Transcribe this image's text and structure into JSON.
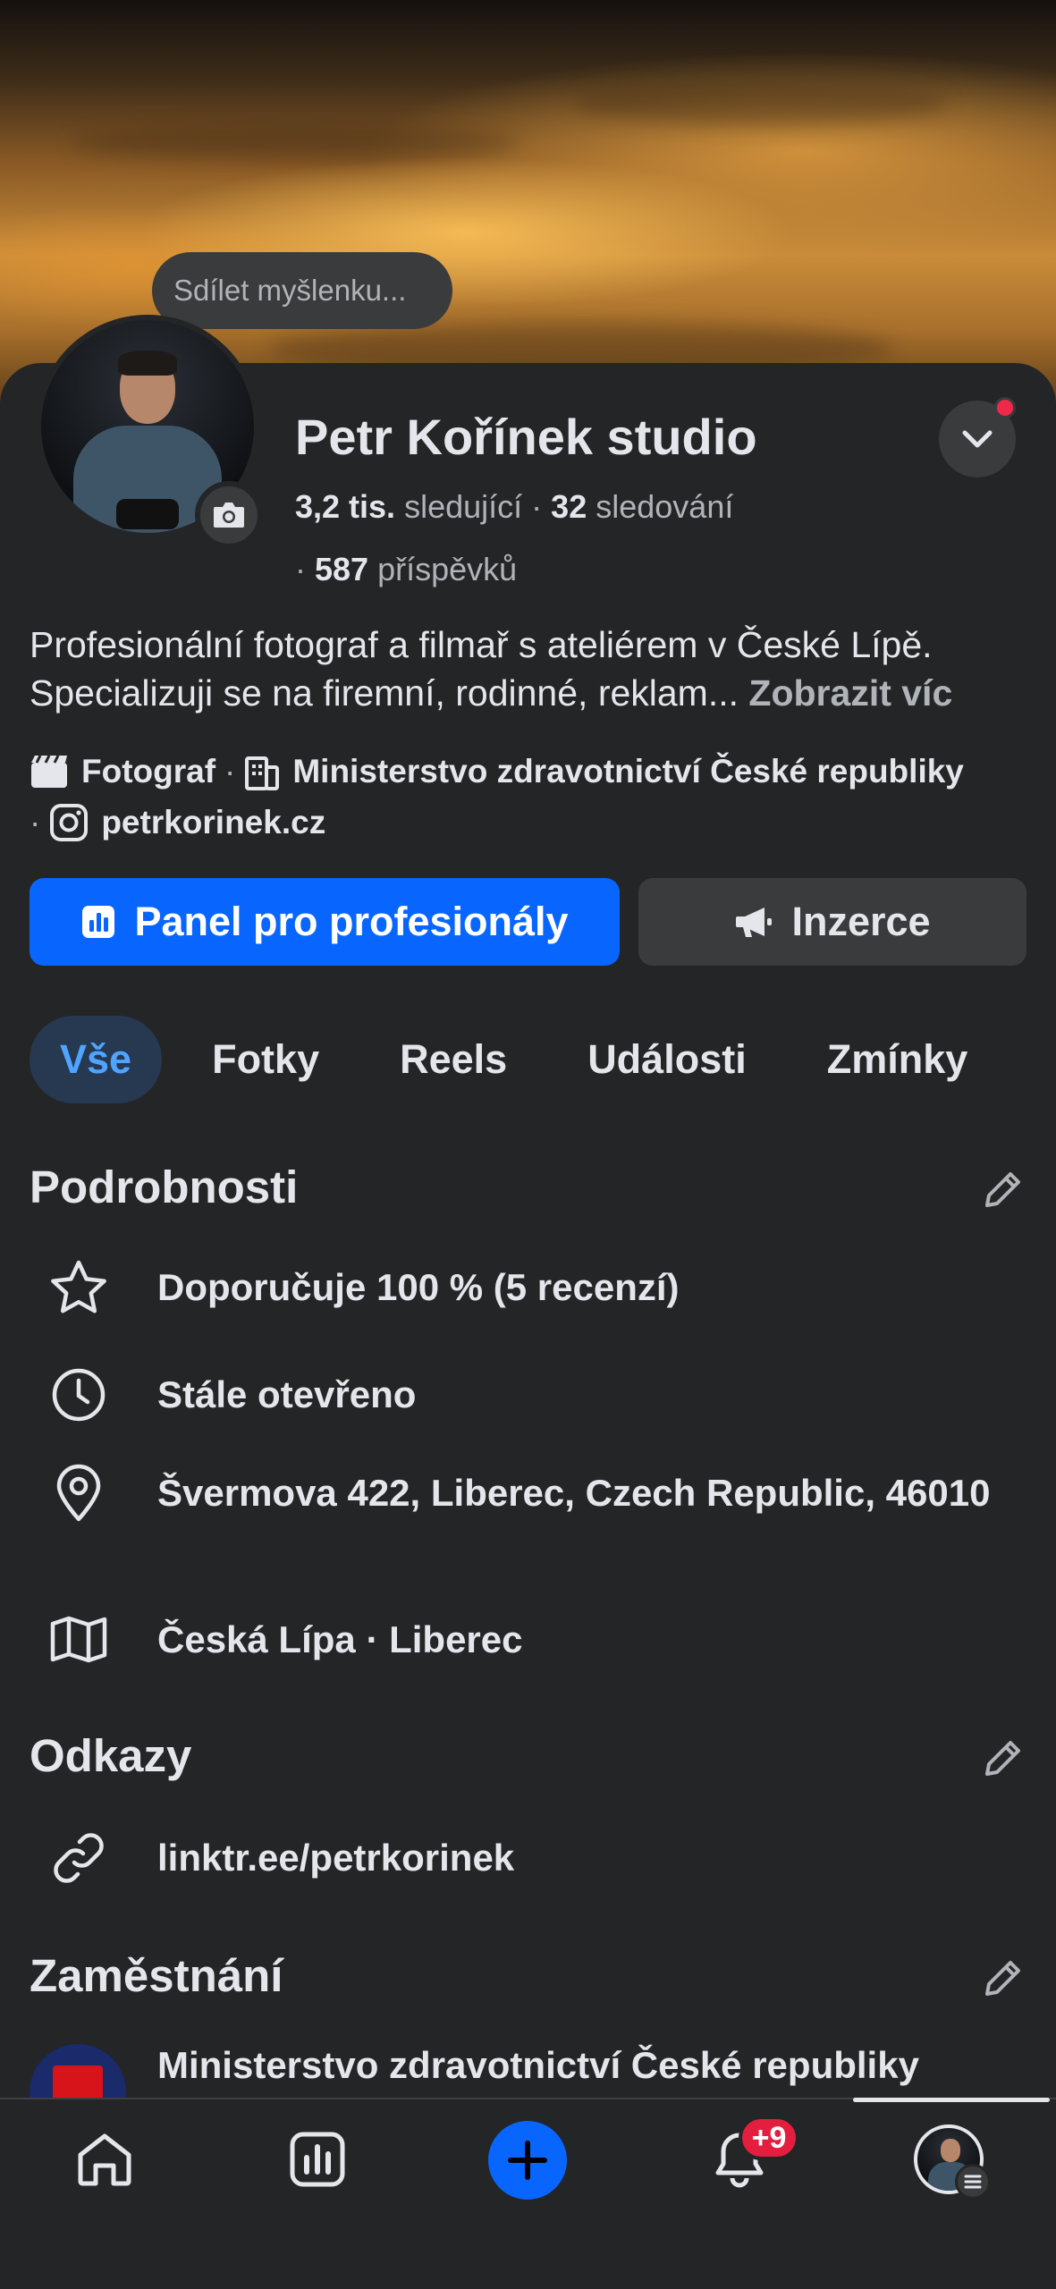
{
  "composer": {
    "placeholder": "Sdílet myšlenku..."
  },
  "profile": {
    "name": "Petr Kořínek studio",
    "followers_count": "3,2 tis.",
    "followers_label": "sledující",
    "following_count": "32",
    "following_label": "sledování",
    "posts_count": "587",
    "posts_label": "příspěvků"
  },
  "bio": {
    "text": "Profesionální fotograf a filmař s ateliérem v České Lípě. Specializuji se na firemní, rodinné, reklam...",
    "more_label": "Zobrazit víc"
  },
  "meta": {
    "category": "Fotograf",
    "workplace": "Ministerstvo zdravotnictví České republiky",
    "website": "petrkorinek.cz"
  },
  "actions": {
    "primary_label": "Panel pro profesionály",
    "secondary_label": "Inzerce"
  },
  "tabs": [
    {
      "label": "Vše",
      "active": true
    },
    {
      "label": "Fotky"
    },
    {
      "label": "Reels"
    },
    {
      "label": "Události"
    },
    {
      "label": "Zmínky"
    }
  ],
  "details": {
    "title": "Podrobnosti",
    "items": [
      {
        "icon": "star-icon",
        "text": "Doporučuje 100 % (5 recenzí)"
      },
      {
        "icon": "clock-icon",
        "text": "Stále otevřeno"
      },
      {
        "icon": "location-pin-icon",
        "text": "Švermova 422, Liberec, Czech Republic, 46010"
      },
      {
        "icon": "map-icon",
        "text": "Česká Lípa · Liberec"
      }
    ]
  },
  "links": {
    "title": "Odkazy",
    "items": [
      {
        "icon": "link-icon",
        "text": "linktr.ee/petrkorinek"
      }
    ]
  },
  "employment": {
    "title": "Zaměstnání",
    "items": [
      {
        "icon": "ministry-logo",
        "text": "Ministerstvo zdravotnictví České republiky"
      }
    ]
  },
  "nav": {
    "notifications_badge": "+9"
  },
  "colors": {
    "accent": "#0866ff",
    "background": "#242526",
    "surface": "#3a3b3c",
    "badge": "#e41e3f"
  }
}
